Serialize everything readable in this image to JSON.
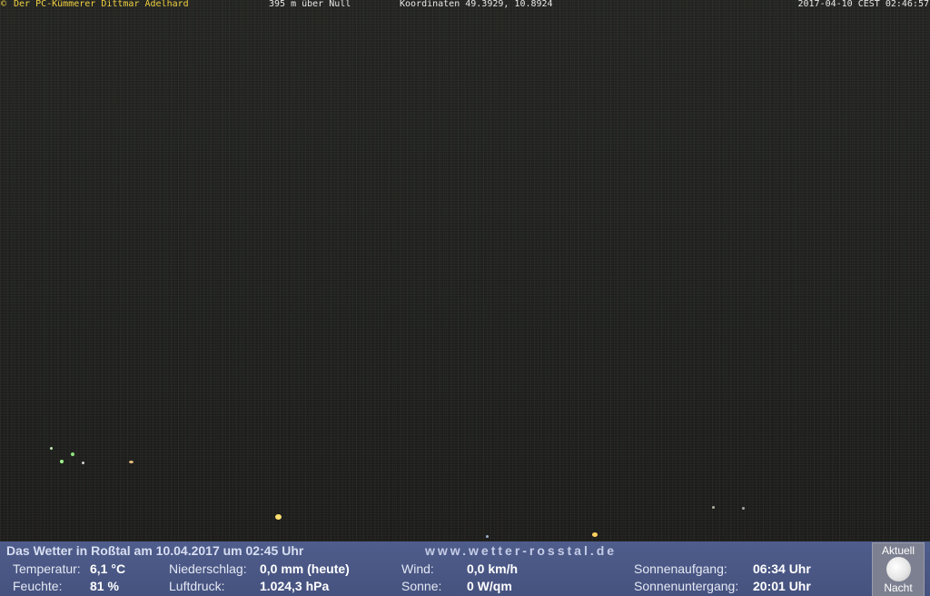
{
  "overlay": {
    "copyright": "©",
    "operator": "Der PC-Kümmerer Dittmar Adelhard",
    "altitude": "395 m über Null",
    "coordinates": "Koordinaten 49.3929, 10.8924",
    "timestamp": "2017-04-10 CEST 02:46:57"
  },
  "weather": {
    "title": "Das Wetter in Roßtal am 10.04.2017 um 02:45 Uhr",
    "website": "www.wetter-rosstal.de",
    "temperature_label": "Temperatur:",
    "temperature_value": "6,1 °C",
    "humidity_label": "Feuchte:",
    "humidity_value": "81 %",
    "precipitation_label": "Niederschlag:",
    "precipitation_value": "0,0 mm (heute)",
    "pressure_label": "Luftdruck:",
    "pressure_value": "1.024,3 hPa",
    "wind_label": "Wind:",
    "wind_value": "0,0 km/h",
    "sun_label": "Sonne:",
    "sun_value": "0 W/qm",
    "sunrise_label": "Sonnenaufgang:",
    "sunrise_value": "06:34 Uhr",
    "sunset_label": "Sonnenuntergang:",
    "sunset_value": "20:01 Uhr"
  },
  "moon": {
    "top_label": "Aktuell",
    "bottom_label": "Nacht",
    "icon": "full-moon-icon"
  },
  "colors": {
    "panel": "#4f5d8c",
    "overlay_text": "#e8e8e8",
    "operator_text": "#f0d040"
  }
}
